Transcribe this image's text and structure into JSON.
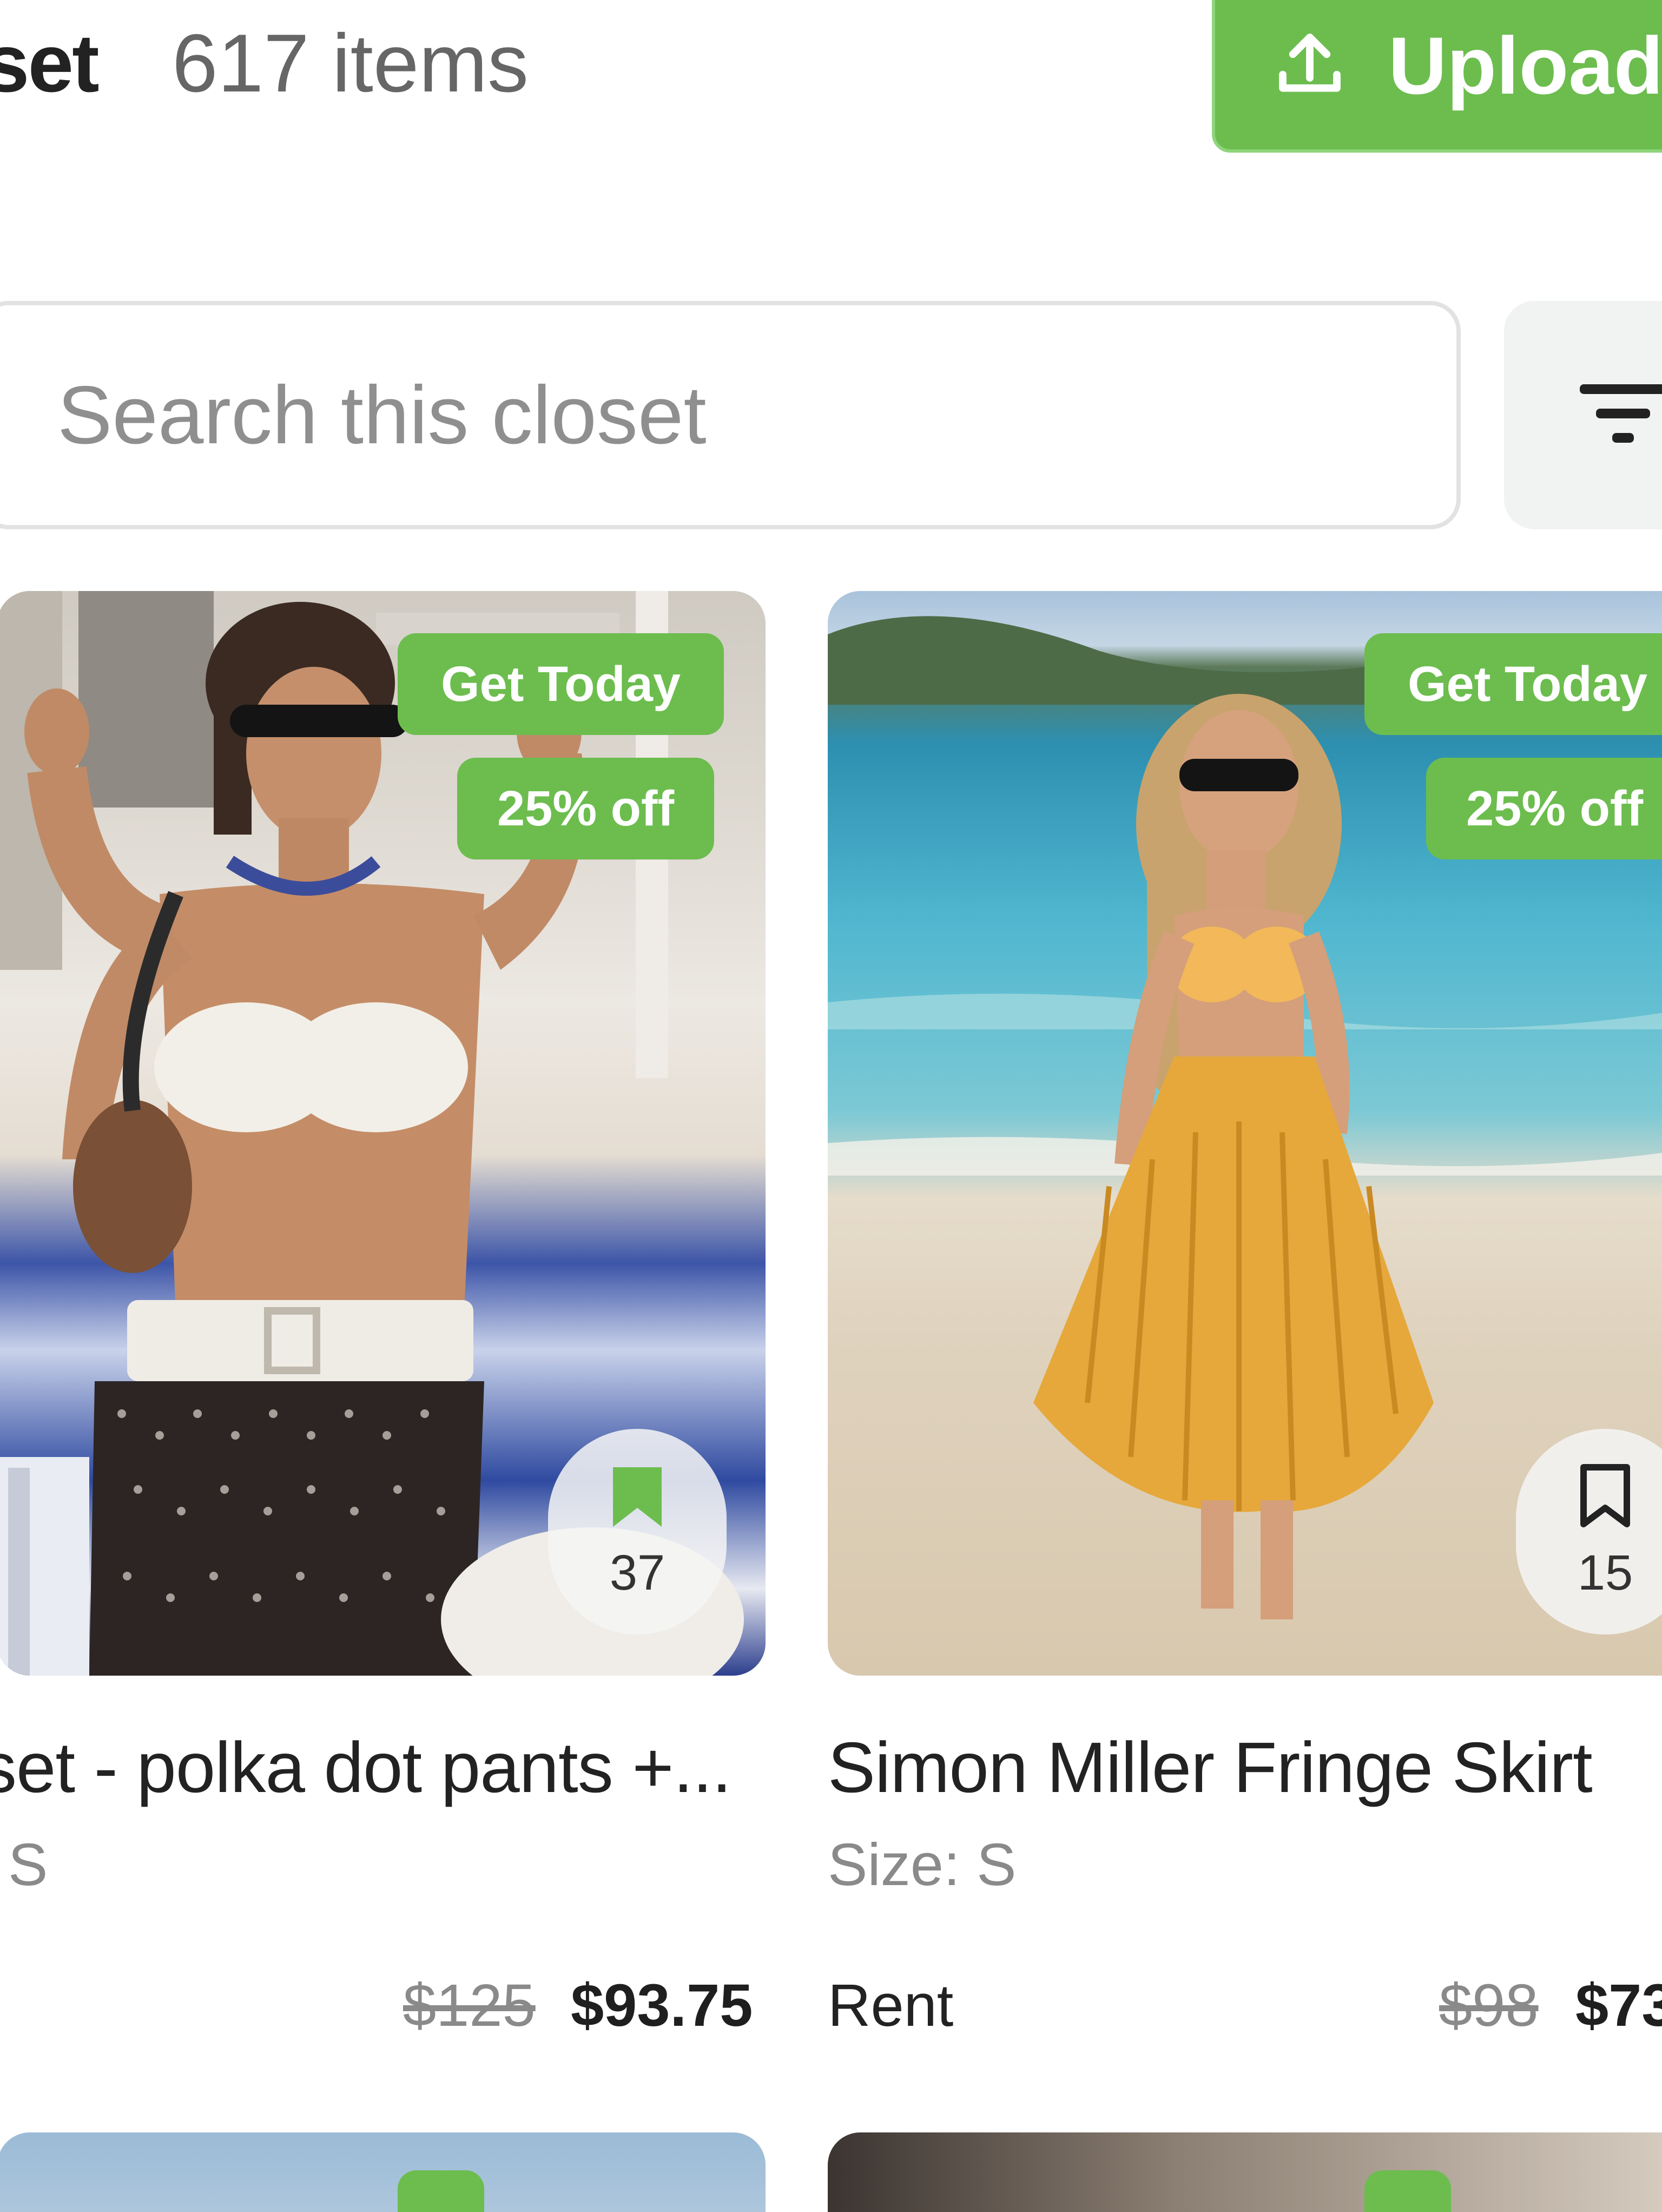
{
  "header": {
    "closet_title": "set",
    "item_count": "617 items",
    "upload_label": "Upload"
  },
  "search": {
    "placeholder": "Search this closet"
  },
  "colors": {
    "accent_green": "#6cbd4e",
    "border": "#e2e2e2",
    "muted_text": "#8a8a8a"
  },
  "cards": [
    {
      "badge_primary": "Get Today",
      "badge_discount": "25% off",
      "saves": "37",
      "saved": true,
      "title": "set - polka dot pants +...",
      "size": "S",
      "old_price": "$125",
      "new_price": "$93.75"
    },
    {
      "badge_primary": "Get Today",
      "badge_discount": "25% off",
      "saves": "15",
      "saved": false,
      "title": "Simon Miller Fringe Skirt",
      "size": "Size: S",
      "rent_label": "Rent",
      "old_price": "$98",
      "new_price": "$73"
    }
  ],
  "icons": {
    "upload": "upload-icon",
    "filter": "filter-icon",
    "bookmark_filled": "bookmark-filled-icon",
    "bookmark_outline": "bookmark-outline-icon"
  }
}
